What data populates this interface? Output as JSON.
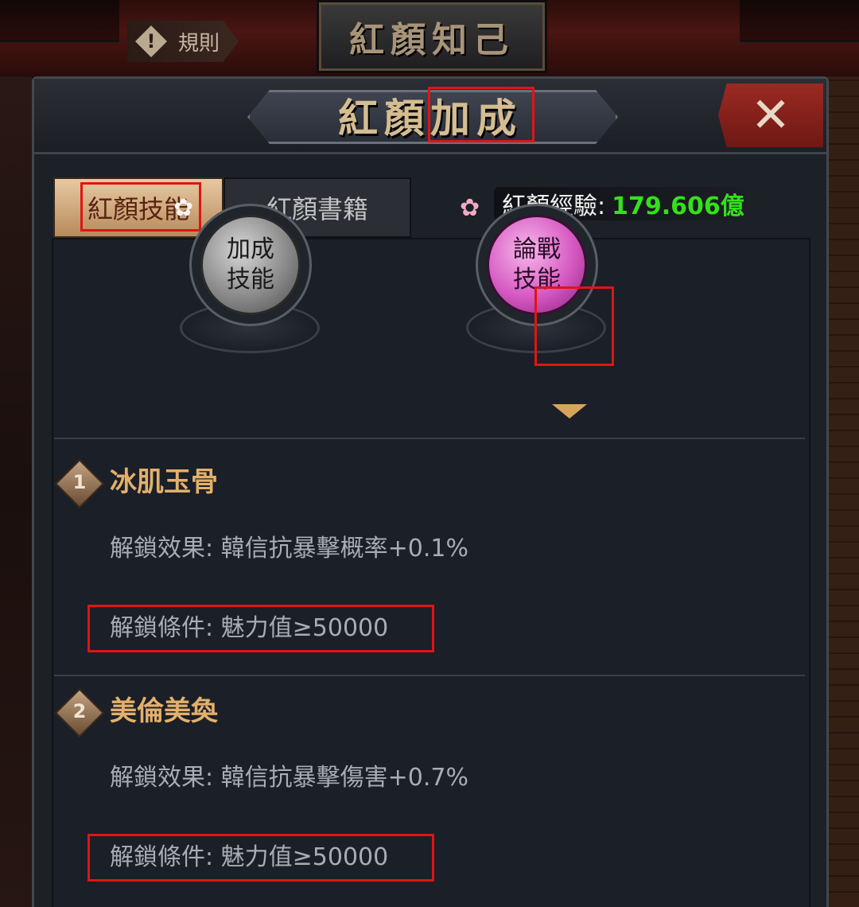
{
  "top": {
    "rules_label": "規則",
    "banner_title": "紅顏知己"
  },
  "dialog": {
    "title_part1": "紅顏",
    "title_part2": "加成",
    "close_symbol": "✕"
  },
  "tabs": [
    {
      "label": "紅顏技能",
      "active": true
    },
    {
      "label": "紅顏書籍",
      "active": false
    }
  ],
  "experience": {
    "label": "紅顏經驗:",
    "value": "179.606億"
  },
  "skill_types": [
    {
      "line1": "加成",
      "line2": "技能",
      "style": "grey",
      "selected": false
    },
    {
      "line1": "論戰",
      "line2": "技能",
      "style": "pink",
      "selected": true
    }
  ],
  "skills": [
    {
      "number": "1",
      "name": "冰肌玉骨",
      "effect": "解鎖效果:  韓信抗暴擊概率+0.1%",
      "condition": "解鎖條件:  魅力值≥50000"
    },
    {
      "number": "2",
      "name": "美倫美奐",
      "effect": "解鎖效果:  韓信抗暴擊傷害+0.7%",
      "condition": "解鎖條件:  魅力值≥50000"
    }
  ],
  "colors": {
    "accent_gold": "#e3b06b",
    "experience_green": "#33e11b",
    "highlight_red": "#e11414",
    "panel_bg": "#1c2027"
  }
}
